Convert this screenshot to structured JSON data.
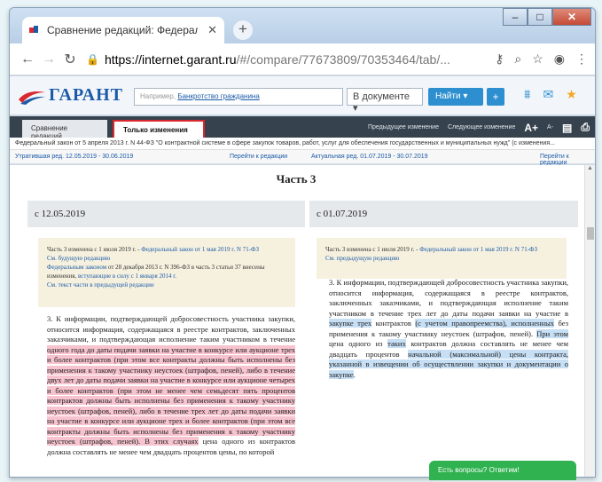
{
  "browser": {
    "tab_title": "Сравнение редакций: Федерал",
    "tab_close": "✕",
    "new_tab": "+",
    "url_host": "https://internet.garant.ru",
    "url_path": "/#/compare/77673809/70353464/tab/...",
    "window_min": "–",
    "window_max": "□",
    "window_close": "✕"
  },
  "garant": {
    "logo": "ГАРАНТ",
    "search_placeholder": "Например,",
    "search_example": "Банкротство гражданина",
    "scope": "В документе ▾",
    "find": "Найти ▾",
    "plus": "+"
  },
  "mode": {
    "tab_compare": "Сравнение редакций",
    "tab_changes": "Только изменения",
    "prev_change": "Предыдущее изменение",
    "next_change": "Следующее изменение",
    "font_large": "A+",
    "font_small": "A-"
  },
  "document": {
    "title": "Федеральный закон от 5 апреля 2013 г. N 44-ФЗ \"О контрактной системе в сфере закупок товаров, работ, услуг для обеспечения государственных и муниципальных нужд\" (с изменения...",
    "left_redaction": "Утратившая ред. 12.05.2019 - 30.06.2019",
    "left_goto": "Перейти к редакции",
    "right_redaction": "Актуальная ред. 01.07.2019 - 30.07.2019",
    "right_goto": "Перейти к редакции",
    "part": "Часть 3",
    "left_date": "с 12.05.2019",
    "right_date": "с 01.07.2019"
  },
  "notes": {
    "left_line1": "Часть 3 изменена с 1 июля 2019 г. - ",
    "left_link1": "Федеральный закон от 1 мая 2019 г. N 71-ФЗ",
    "left_link2": "См. будущую редакцию",
    "left_link3": "Федеральным законом",
    "left_line4": " от 28 декабря 2013 г. N 396-ФЗ в часть 3 статьи 37 внесены изменения, ",
    "left_link4": "вступающие в силу с 1 января 2014 г.",
    "left_link5": "См. текст части в предыдущей редакции",
    "right_line1": "Часть 3 изменена с 1 июля 2019 г. - ",
    "right_link1": "Федеральный закон от 1 мая 2019 г. N 71-ФЗ",
    "right_link2": "См. предыдущую редакцию"
  },
  "left_text": {
    "a": "3. К информации, подтверждающей добросовестность участника закупки, относится информация, содержащаяся в реестре контрактов, заключенных заказчиками, и подтверждающая исполнение таким участником в течение ",
    "b": "одного года до даты подачи заявки на участие в конкурсе или аукционе трех и более контрактов (при этом все контракты должны быть исполнены без применения к такому участнику неустоек (штрафов, пеней), либо в течение двух лет до даты подачи заявки на участие в конкурсе или аукционе четырех и более контрактов (при этом не менее чем семьдесят пять процентов контрактов должны быть исполнены без применения к такому участнику неустоек (штрафов, пеней), либо в течение трех лет до даты подачи заявки на участие в конкурсе или аукционе трех и более контрактов (при этом все контракты должны быть исполнены без применения к такому участнику неустоек (штрафов, пеней). В этих случаях",
    "c": " цена одного из контрактов должна составлять не менее чем двадцать процентов цены, по которой"
  },
  "right_text": {
    "a": "3. К информации, подтверждающей добросовестность участника закупки, относится информация, содержащаяся в реестре контрактов, заключенных заказчиками, и подтверждающая исполнение таким участником в течение трех лет до даты подачи заявки на участие в ",
    "b": "закупке трех",
    "c": " контрактов ",
    "d": "(с учетом правопреемства), исполненных",
    "e": " без применения к такому участнику неустоек (штрафов, пеней). ",
    "f": "При этом",
    "g": " цена одного из ",
    "h": "таких",
    "i": " контрактов должна составлять не менее чем двадцать процентов ",
    "j": "начальной (максимальной) цены контракта, указанной в извещении об осуществлении закупки и документации о закупке",
    "k": "."
  },
  "chat": "Есть вопросы? Ответим!",
  "colors": {
    "accent": "#2d8fd0",
    "deleted": "#f6c3cf",
    "added": "#c6dff5",
    "note_bg": "#f6f1df"
  }
}
